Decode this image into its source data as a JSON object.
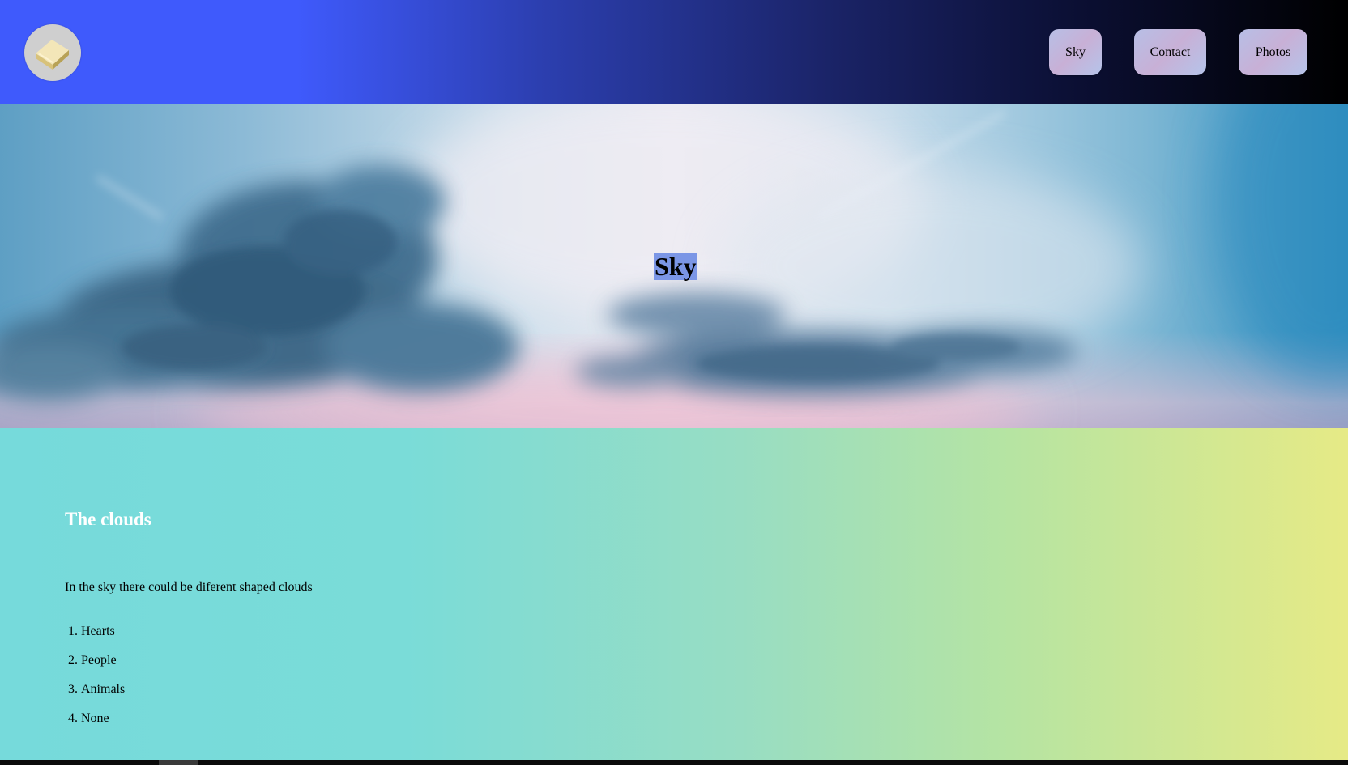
{
  "header": {
    "logo_icon": "book-icon",
    "nav": [
      {
        "label": "Sky"
      },
      {
        "label": "Contact"
      },
      {
        "label": "Photos"
      }
    ],
    "colors": {
      "gradient_start": "#3f5afc",
      "gradient_end": "#000000"
    }
  },
  "hero": {
    "title": "Sky",
    "title_highlight": "#7b96e6"
  },
  "content": {
    "heading": "The clouds",
    "paragraph": "In the sky there could be diferent shaped clouds",
    "list": [
      "Hearts",
      "People",
      "Animals",
      "None"
    ],
    "colors": {
      "gradient_start": "#76dadb",
      "gradient_end": "#e6ea86"
    }
  }
}
